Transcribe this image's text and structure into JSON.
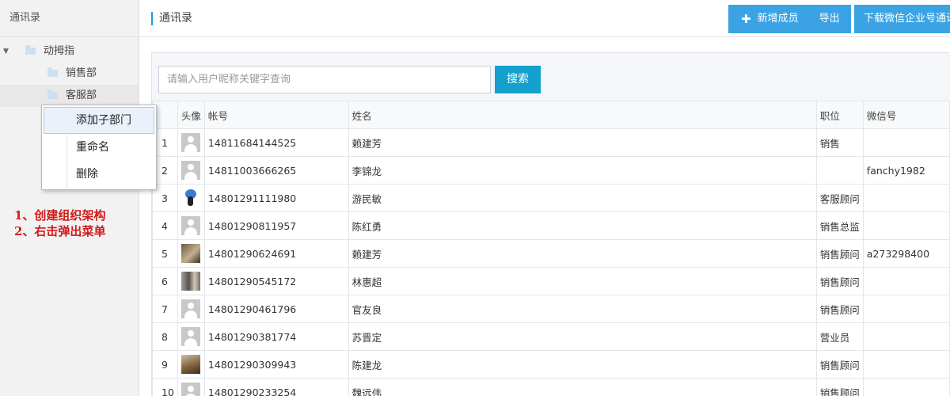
{
  "sidebar": {
    "title": "通讯录",
    "tree": [
      {
        "label": "动拇指",
        "toggle": "▼"
      },
      {
        "label": "销售部"
      },
      {
        "label": "客服部"
      }
    ]
  },
  "context_menu": {
    "items": [
      "添加子部门",
      "重命名",
      "删除"
    ]
  },
  "annotation": {
    "line1": "1、创建组织架构",
    "line2": "2、右击弹出菜单"
  },
  "header": {
    "title": "通讯录",
    "add_member": "新增成员",
    "export": "导出",
    "download": "下载微信企业号通讯录"
  },
  "search": {
    "placeholder": "请输入用户昵称关键字查询",
    "button": "搜索"
  },
  "table": {
    "columns": [
      "",
      "头像",
      "帐号",
      "姓名",
      "职位",
      "微信号"
    ],
    "rows": [
      {
        "index": "1",
        "avatar": "default",
        "account": "14811684144525",
        "name": "赖建芳",
        "position": "销售",
        "wechat": ""
      },
      {
        "index": "2",
        "avatar": "default",
        "account": "14811003666265",
        "name": "李锦龙",
        "position": "",
        "wechat": "fanchy1982"
      },
      {
        "index": "3",
        "avatar": "cartoon",
        "account": "14801291111980",
        "name": "游民敏",
        "position": "客服顾问",
        "wechat": ""
      },
      {
        "index": "4",
        "avatar": "default",
        "account": "14801290811957",
        "name": "陈红勇",
        "position": "销售总监",
        "wechat": ""
      },
      {
        "index": "5",
        "avatar": "photo1",
        "account": "14801290624691",
        "name": "赖建芳",
        "position": "销售顾问",
        "wechat": "a273298400"
      },
      {
        "index": "6",
        "avatar": "photo2",
        "account": "14801290545172",
        "name": "林惠超",
        "position": "销售顾问",
        "wechat": ""
      },
      {
        "index": "7",
        "avatar": "default",
        "account": "14801290461796",
        "name": "官友良",
        "position": "销售顾问",
        "wechat": ""
      },
      {
        "index": "8",
        "avatar": "default",
        "account": "14801290381774",
        "name": "苏晋定",
        "position": "营业员",
        "wechat": ""
      },
      {
        "index": "9",
        "avatar": "photo3",
        "account": "14801290309943",
        "name": "陈建龙",
        "position": "销售顾问",
        "wechat": ""
      },
      {
        "index": "10",
        "avatar": "default",
        "account": "14801290233254",
        "name": "魏远伟",
        "position": "销售顾问",
        "wechat": ""
      }
    ]
  },
  "colors": {
    "accent": "#3ba3e3",
    "search_button": "#14a0cc",
    "annotation": "#d01a1a"
  }
}
